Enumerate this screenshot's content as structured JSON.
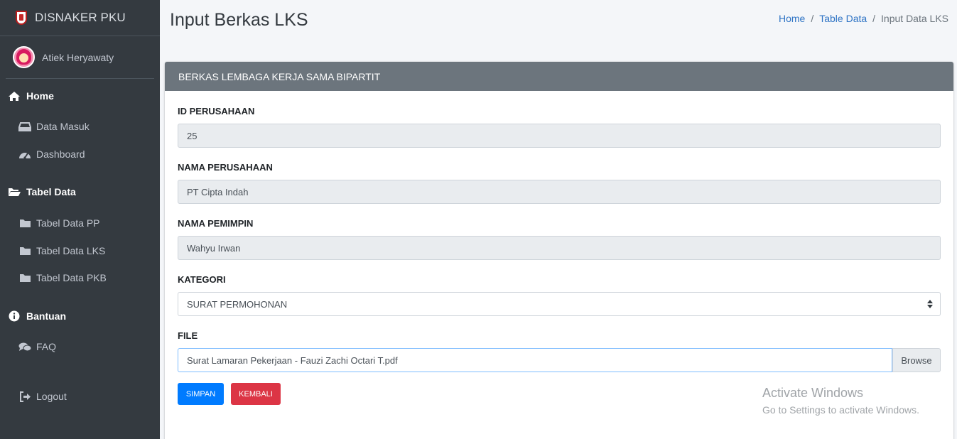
{
  "brand": {
    "name": "DISNAKER PKU"
  },
  "user": {
    "name": "Atiek Heryawaty"
  },
  "sidebar": {
    "home": "Home",
    "data_masuk": "Data Masuk",
    "dashboard": "Dashboard",
    "tabel_data": "Tabel Data",
    "tabel_pp": "Tabel Data PP",
    "tabel_lks": "Tabel Data LKS",
    "tabel_pkb": "Tabel Data PKB",
    "bantuan": "Bantuan",
    "faq": "FAQ",
    "logout": "Logout"
  },
  "header": {
    "title": "Input Berkas LKS",
    "breadcrumb": [
      "Home",
      "Table Data",
      "Input Data LKS"
    ],
    "separator": "/"
  },
  "card": {
    "title": "BERKAS LEMBAGA KERJA SAMA BIPARTIT"
  },
  "form": {
    "id_label": "ID PERUSAHAAN",
    "id_value": "25",
    "nama_label": "NAMA PERUSAHAAN",
    "nama_value": "PT Cipta Indah",
    "pemimpin_label": "NAMA PEMIMPIN",
    "pemimpin_value": "Wahyu Irwan",
    "kategori_label": "KATEGORI",
    "kategori_value": "SURAT PERMOHONAN",
    "file_label": "FILE",
    "file_value": "Surat Lamaran Pekerjaan - Fauzi Zachi Octari T.pdf",
    "browse_label": "Browse",
    "save_label": "SIMPAN",
    "back_label": "KEMBALI"
  },
  "watermark": {
    "title": "Activate Windows",
    "subtitle": "Go to Settings to activate Windows."
  },
  "colors": {
    "sidebar_bg": "#343a40",
    "card_header_bg": "#6c757d",
    "primary": "#007bff",
    "danger": "#dc3545",
    "link": "#2f74c5"
  },
  "icons": {
    "home": "home-icon",
    "data_masuk": "inbox-icon",
    "dashboard": "tachometer-icon",
    "tabel_data": "folder-open-icon",
    "tabel_item": "folder-icon",
    "bantuan": "info-circle-icon",
    "faq": "comments-icon",
    "logout": "sign-out-icon"
  }
}
